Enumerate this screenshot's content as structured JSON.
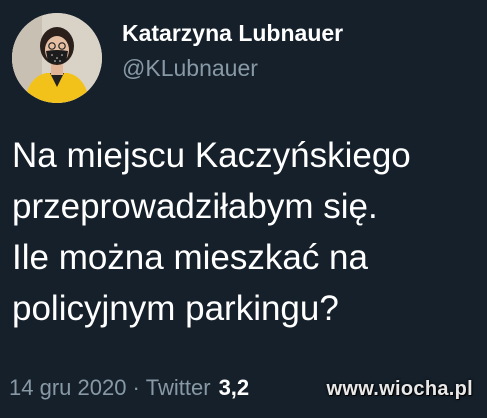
{
  "tweet": {
    "author": {
      "display_name": "Katarzyna Lubnauer",
      "handle": "@KLubnauer",
      "avatar_icon": "avatar-photo"
    },
    "text_lines": [
      "Na miejscu Kaczyńskiego",
      "przeprowadziłabym się.",
      "Ile można mieszkać na",
      "policyjnym parkingu?"
    ],
    "footer": {
      "date": "14 gru 2020",
      "separator": "·",
      "source": "Twitter",
      "count": "3,2"
    }
  },
  "watermark": {
    "text": "www.wiocha.pl"
  },
  "colors": {
    "background": "#15202b",
    "primary_text": "#ffffff",
    "secondary_text": "#8899a6"
  }
}
